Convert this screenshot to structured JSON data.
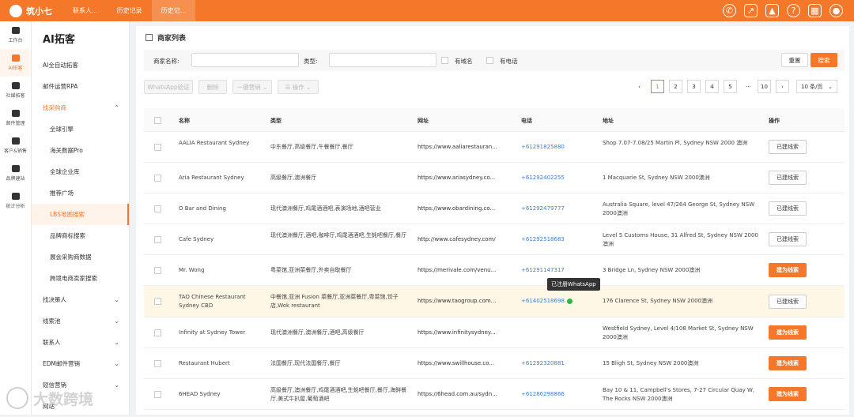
{
  "app": {
    "name": "筑小七"
  },
  "tabs": [
    "联系人...",
    "历史记录",
    "历史记..."
  ],
  "rail": [
    "工作台",
    "AI拓客",
    "社媒拓客",
    "邮件管理",
    "客户&销售",
    "品牌建站",
    "统计分析"
  ],
  "sidebar": {
    "title": "AI拓客",
    "items": [
      "AI全自动拓客",
      "邮件运营RPA",
      "找采购商",
      "全球引擎",
      "海关数据Pro",
      "全球企业库",
      "推荐广场",
      "LBS地图搜索",
      "品牌商标搜索",
      "展会采购商数据",
      "跨境电商卖家搜索",
      "找决策人",
      "线索池",
      "联系人",
      "EDM邮件营销",
      "短信营销",
      "网站"
    ]
  },
  "panel": {
    "title": "商家列表"
  },
  "filter": {
    "name_label": "商家名称:",
    "type_label": "类型:",
    "has_domain": "有域名",
    "has_phone": "有电话",
    "reset": "重置",
    "search": "搜索"
  },
  "toolbar": {
    "whatsapp_verify": "WhatsApp验证",
    "delete": "删除",
    "one_click": "一键营销",
    "ops": "操作"
  },
  "pagination": {
    "pages": [
      "1",
      "2",
      "3",
      "4",
      "5",
      "···",
      "10"
    ],
    "page_size": "10 条/页"
  },
  "table": {
    "headers": [
      "名称",
      "类型",
      "网址",
      "电话",
      "地址",
      "操作"
    ],
    "rows": [
      {
        "name": "AALIA Restaurant Sydney",
        "type": "中东餐厅,高级餐厅,午餐餐厅,餐厅",
        "url": "https://www.aaliarestauran...",
        "phone": "+61291825880",
        "address": "Shop 7.07-7.08/25 Martin Pl, Sydney NSW 2000 澳洲",
        "action": "已建线索"
      },
      {
        "name": "Aria Restaurant Sydney",
        "type": "高级餐厅,澳洲餐厅",
        "url": "https://www.ariasydney.co...",
        "phone": "+61292402255",
        "address": "1 Macquarie St, Sydney NSW 2000澳洲",
        "action": "已建线索"
      },
      {
        "name": "O Bar and Dining",
        "type": "现代澳洲餐厅,鸡尾酒酒吧,表演场地,酒吧营业",
        "url": "https://www.obardining.co...",
        "phone": "+61292479777",
        "address": "Australia Square, level 47/264 George St, Sydney NSW 2000澳洲",
        "action": "已建线索"
      },
      {
        "name": "Cafe Sydney",
        "type": "现代澳洲餐厅,酒吧,咖啡厅,鸡尾酒酒吧,生蚝吧餐厅,餐厅",
        "url": "http://www.cafesydney.com/",
        "phone": "+61292518683",
        "address": "Level 5 Customs House, 31 Alfred St, Sydney NSW 2000澳洲",
        "action": "已建线索"
      },
      {
        "name": "Mr. Wong",
        "type": "粤菜馆,亚洲菜餐厅,外卖自取餐厅",
        "url": "https://merivale.com/venu...",
        "phone": "+61291147317",
        "address": "3 Bridge Ln, Sydney NSW 2000澳洲",
        "action": "建为线索"
      },
      {
        "name": "TAO Chinese Restaurant Sydney CBD",
        "type": "中餐馆,亚洲 Fusion 菜餐厅,亚洲菜餐厅,粤菜馆,饺子店,Wok restaurant",
        "url": "https://www.taogroup.com...",
        "phone": "+61402518698",
        "address": "176 Clarence St, Sydney NSW 2000澳洲",
        "action": "已建线索"
      },
      {
        "name": "Infinity at Sydney Tower",
        "type": "现代澳洲餐厅,澳洲餐厅,酒吧,高级餐厅",
        "url": "https://www.infinitysydney...",
        "phone": "",
        "address": "Westfield Sydney, Level 4/108 Market St, Sydney NSW 2000澳洲",
        "action": "建为线索"
      },
      {
        "name": "Restaurant Hubert",
        "type": "法国餐厅,现代法国餐厅,餐厅",
        "url": "https://www.swillhouse.co...",
        "phone": "+61292320881",
        "address": "15 Bligh St, Sydney NSW 2000澳洲",
        "action": "建为线索"
      },
      {
        "name": "6HEAD Sydney",
        "type": "高级餐厅,澳洲餐厅,鸡尾酒酒吧,生蚝吧餐厅,餐厅,海鲜餐厅,美式牛扒屋,葡萄酒吧",
        "url": "https://6head.com.au/sydn...",
        "phone": "+61286298866",
        "address": "Bay 10 & 11, Campbell's Stores, 7-27 Circular Quay W, The Rocks NSW 2000澳洲",
        "action": "建为线索"
      }
    ]
  },
  "tooltip": "已注册WhatsApp",
  "watermark": "大数跨境",
  "colors": {
    "accent": "#f5782a",
    "phone": "#3c7fd1",
    "highlight_row": "#fff7e6"
  }
}
